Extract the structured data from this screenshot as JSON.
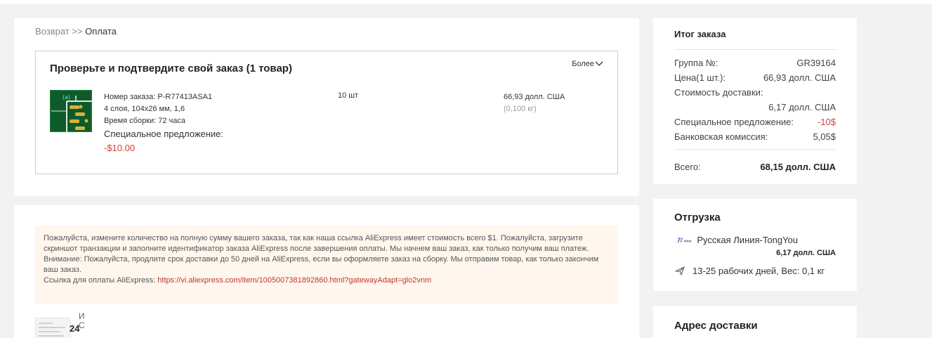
{
  "breadcrumb": {
    "back": "Возврат",
    "sep": " >> ",
    "current": "Оплата"
  },
  "order": {
    "title": "Проверьте и подтвердите свой заказ (1 товар)",
    "more_label": "Более",
    "item": {
      "number": "Номер заказа: P-R77413ASA1",
      "spec": "4 слоя, 104x26 мм, 1,6",
      "build_time": "Время сборки: 72 часа",
      "promo_label": "Специальное предложение:",
      "promo_value": "-$10.00",
      "qty": "10 шт",
      "price": "66,93 долл. США",
      "weight": "(0,100 кг)"
    }
  },
  "notice": {
    "line1": "Пожалуйста, измените количество на полную сумму вашего заказа, так как наша ссылка AliExpress имеет стоимость всего $1. Пожалуйста, загрузите скриншот транзакции и заполните идентификатор заказа AliExpress после завершения оплаты. Мы начнем ваш заказ, как только получим ваш платеж.",
    "line2": "Внимание: Пожалуйста, продлите срок доставки до 50 дней на AliExpress, если вы оформляете заказ на сборку. Мы отправим товар, как только закончим ваш заказ.",
    "link_label": "Ссылка для оплаты AliExpress: ",
    "link_url": "https://vi.aliexpress.com/item/1005007381892860.html?gatewayAdapt=glo2vnm"
  },
  "attachment": {
    "badge": "24",
    "side_top": "И",
    "side_bottom": "С"
  },
  "summary": {
    "title": "Итог заказа",
    "group_label": "Группа №:",
    "group_value": "GR39164",
    "price_label": "Цена(1 шт.):",
    "price_value": "66,93 долл. США",
    "shipping_label": "Стоимость доставки:",
    "shipping_value": "6,17 долл. США",
    "promo_label": "Специальное предложение:",
    "promo_value": "-10$",
    "bank_label": "Банковская комиссия:",
    "bank_value": "5,05$",
    "total_label": "Всего:",
    "total_value": "68,15 долл. США"
  },
  "shipment": {
    "title": "Отгрузка",
    "carrier_logo": "7/",
    "carrier_logo_sub": "■■■",
    "carrier_name": "Русская Линия-TongYou",
    "price": "6,17 долл. США",
    "delivery": "13-25 рабочих дней, Вес: 0,1 кг"
  },
  "address": {
    "title": "Адрес доставки"
  },
  "colors": {
    "accent_red": "#d0403b",
    "notice_bg": "#fff7ee",
    "link": "#c0392b"
  }
}
